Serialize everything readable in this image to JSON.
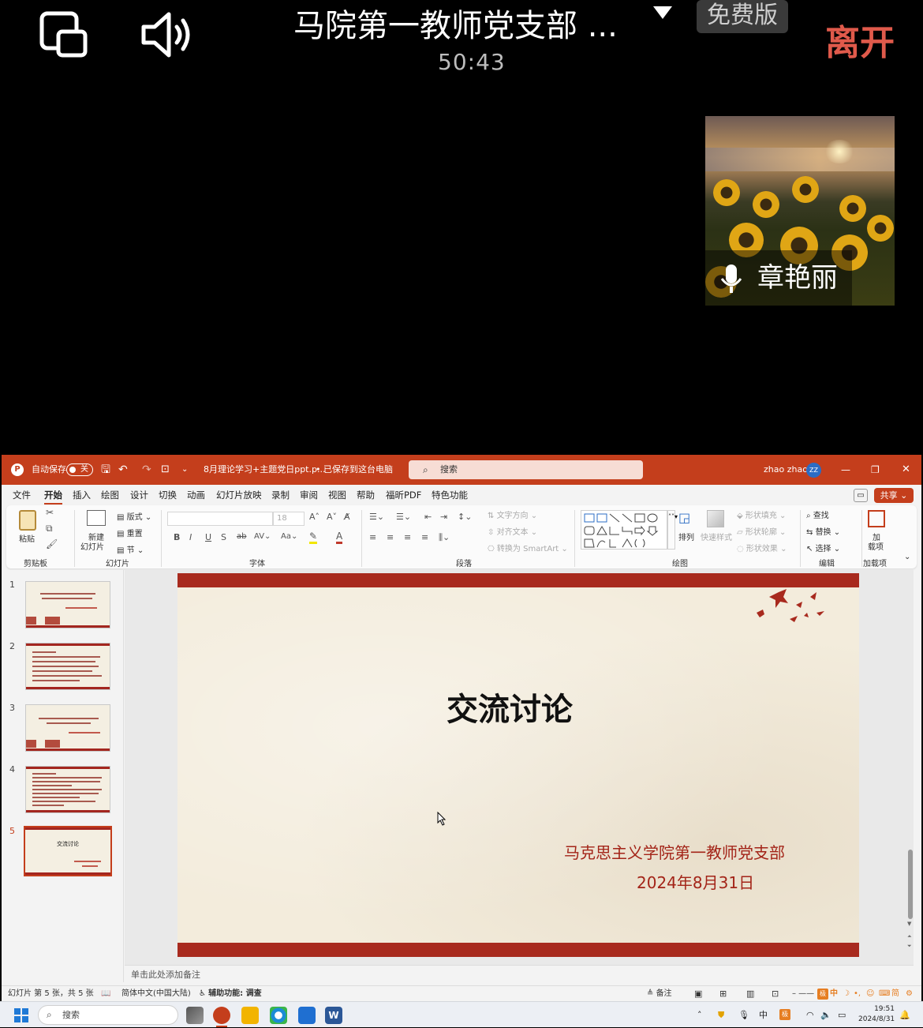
{
  "meeting": {
    "title": "马院第一教师党支部 ...",
    "badge": "免费版",
    "leave_label": "离开",
    "elapsed": "50:43",
    "participant_name": "章艳丽"
  },
  "ppt": {
    "autosave_label": "自动保存",
    "autosave_state": "关",
    "file_name": "8月理论学习+主题党日ppt.p...",
    "save_status": "• 已保存到这台电脑",
    "search_placeholder": "搜索",
    "user_name": "zhao zhao",
    "user_initials": "ZZ",
    "menus": [
      "文件",
      "开始",
      "插入",
      "绘图",
      "设计",
      "切换",
      "动画",
      "幻灯片放映",
      "录制",
      "审阅",
      "视图",
      "帮助",
      "福昕PDF",
      "特色功能"
    ],
    "share_label": "共享",
    "ribbon": {
      "paste": "粘贴",
      "clipboard": "剪贴板",
      "new_slide_1": "新建",
      "new_slide_2": "幻灯片",
      "layout": "版式",
      "reset": "重置",
      "section": "节",
      "slides_group": "幻灯片",
      "font_size": "18",
      "font_group": "字体",
      "text_direction": "文字方向",
      "align_text": "对齐文本",
      "smartart": "转换为 SmartArt",
      "paragraph_group": "段落",
      "arrange": "排列",
      "quick_styles": "快速样式",
      "shape_fill": "形状填充",
      "shape_outline": "形状轮廓",
      "shape_effects": "形状效果",
      "drawing_group": "绘图",
      "find": "查找",
      "replace": "替换",
      "select": "选择",
      "editing_group": "编辑",
      "addins_1": "加",
      "addins_2": "载项",
      "addins_group": "加载项"
    },
    "slides": [
      {
        "num": "1"
      },
      {
        "num": "2"
      },
      {
        "num": "3"
      },
      {
        "num": "4"
      },
      {
        "num": "5",
        "thumb_text": "交流讨论"
      }
    ],
    "current_slide": {
      "title": "交流讨论",
      "org": "马克思主义学院第一教师党支部",
      "date": "2024年8月31日"
    },
    "notes_placeholder": "单击此处添加备注",
    "status": {
      "slide_count": "幻灯片 第 5 张，共 5 张",
      "language": "简体中文(中国大陆)",
      "accessibility": "辅助功能: 调查",
      "notes": "备注",
      "ime": "中"
    }
  },
  "taskbar": {
    "search_placeholder": "搜索",
    "ime": "中",
    "time": "19:51",
    "date": "2024/8/31"
  }
}
